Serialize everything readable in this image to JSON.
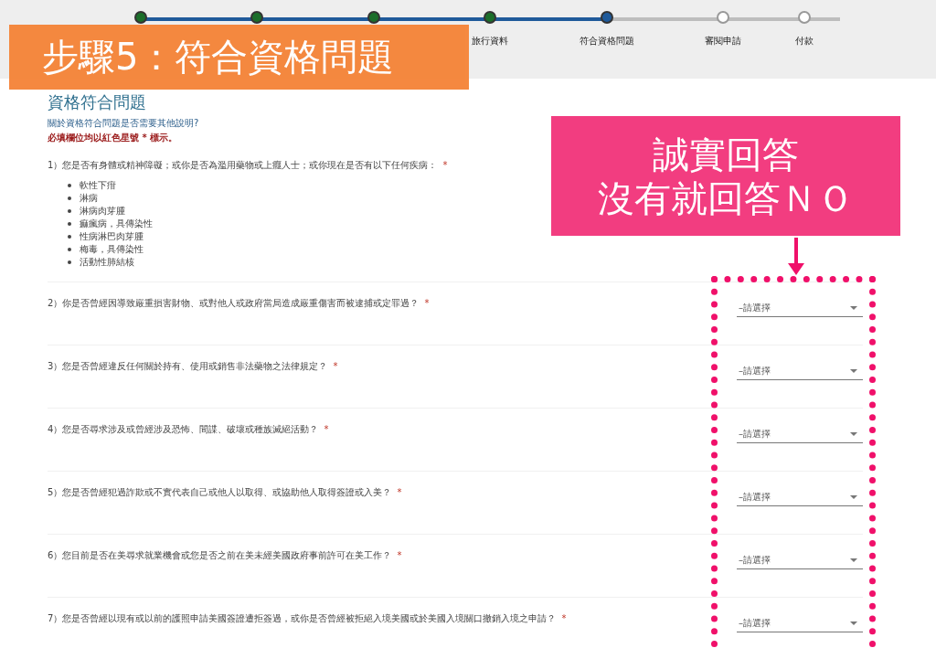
{
  "steps": [
    {
      "completed": true,
      "selected": false
    },
    {
      "completed": true,
      "selected": false
    },
    {
      "completed": true,
      "selected": false
    },
    {
      "completed": true,
      "selected": false,
      "label": "旅行資料"
    },
    {
      "completed": false,
      "selected": true,
      "label": "符合資格問題"
    },
    {
      "completed": false,
      "selected": false,
      "label": "審閱申請"
    },
    {
      "completed": false,
      "selected": false,
      "label": "付款"
    }
  ],
  "section": {
    "title": "資格符合問題",
    "help_link": "關於資格符合問題是否需要其他說明?",
    "required_note": "必填欄位均以紅色星號 * 標示。"
  },
  "questions": [
    {
      "text": "1）您是否有身體或精神障礙；或你是否為濫用藥物或上癮人士；或你現在是否有以下任何疾病：",
      "required_mark": "*",
      "items": [
        "軟性下疳",
        "淋病",
        "淋病肉芽腫",
        "痲瘋病，具傳染性",
        "性病淋巴肉芽腫",
        "梅毒，具傳染性",
        "活動性肺結核"
      ]
    },
    {
      "text": "2）你是否曾經因導致嚴重損害財物、或對他人或政府當局造成嚴重傷害而被逮捕或定罪過？",
      "required_mark": "*",
      "dropdown": {
        "placeholder": "–請選擇"
      }
    },
    {
      "text": "3）您是否曾經違反任何關於持有、使用或銷售非法藥物之法律規定？",
      "required_mark": "*",
      "dropdown": {
        "placeholder": "–請選擇"
      }
    },
    {
      "text": "4）您是否尋求涉及或曾經涉及恐怖、間諜、破壞或種族滅絕活動？",
      "required_mark": "*",
      "dropdown": {
        "placeholder": "–請選擇"
      }
    },
    {
      "text": "5）您是否曾經犯過詐欺或不實代表自己或他人以取得、或協助他人取得簽證或入美？",
      "required_mark": "*",
      "dropdown": {
        "placeholder": "–請選擇"
      }
    },
    {
      "text": "6）您目前是否在美尋求就業機會或您是否之前在美未經美國政府事前許可在美工作？",
      "required_mark": "*",
      "dropdown": {
        "placeholder": "–請選擇"
      }
    },
    {
      "text": "7）您是否曾經以現有或以前的護照申請美國簽證遭拒簽過，或你是否曾經被拒絕入境美國或於美國入境關口撤銷入境之申請？",
      "required_mark": "*",
      "dropdown": {
        "placeholder": "–請選擇"
      }
    }
  ],
  "banner": {
    "text": "步驟5：符合資格問題"
  },
  "callout": {
    "lines": [
      "誠實回答",
      "沒有就回答ＮＯ"
    ]
  }
}
